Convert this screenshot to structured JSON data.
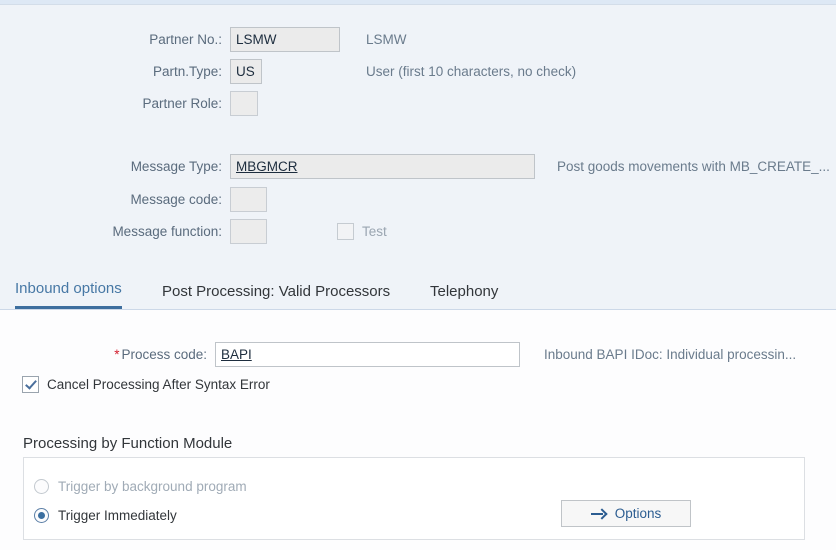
{
  "header_form": {
    "fields": [
      {
        "label": "Partner No.:",
        "value": "LSMW",
        "description": "LSMW",
        "icon": ""
      },
      {
        "label": "Partn.Type:",
        "value": "US",
        "description": "User (first 10 characters, no check)",
        "icon": ""
      },
      {
        "label": "Partner Role:",
        "value": "",
        "description": "",
        "icon": ""
      }
    ],
    "message_fields": [
      {
        "label": "Message Type:",
        "value": "MBGMCR",
        "description": "Post goods movements with MB_CREATE_...",
        "icon": "structure-icon"
      },
      {
        "label": "Message code:",
        "value": "",
        "description": "",
        "icon": ""
      },
      {
        "label": "Message function:",
        "value": "",
        "description": "",
        "icon": ""
      }
    ],
    "test_checkbox": {
      "label": "Test",
      "checked": false,
      "enabled": false
    }
  },
  "tabs": [
    {
      "label": "Inbound options",
      "active": true
    },
    {
      "label": "Post Processing: Valid Processors",
      "active": false
    },
    {
      "label": "Telephony",
      "active": false
    }
  ],
  "inbound_options": {
    "process_code": {
      "required_marker": "*",
      "label": "Process code:",
      "value": "BAPI",
      "description": "Inbound BAPI IDoc: Individual processin..."
    },
    "cancel_processing": {
      "label": "Cancel Processing After Syntax Error",
      "checked": true
    },
    "group": {
      "title": "Processing by Function Module",
      "radios": [
        {
          "label": "Trigger by background program",
          "selected": false,
          "enabled": false
        },
        {
          "label": "Trigger Immediately",
          "selected": true,
          "enabled": true
        }
      ],
      "options_button": {
        "label": "Options",
        "icon": "arrow-right-icon"
      }
    }
  },
  "colors": {
    "panel_background": "#eff3f8",
    "content_background": "#fdfdfe",
    "accent_blue": "#3d6e9e",
    "link_blue": "#2c5d91",
    "required_red": "#d32030",
    "label_grey": "#5a6b7d",
    "description_grey": "#6a7b8c"
  }
}
